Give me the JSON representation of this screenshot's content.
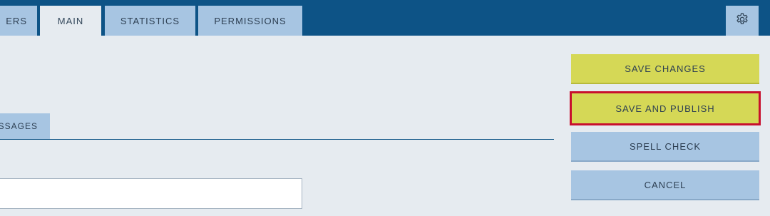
{
  "tabs": [
    {
      "label": "ERS",
      "active": false
    },
    {
      "label": "MAIN",
      "active": true
    },
    {
      "label": "STATISTICS",
      "active": false
    },
    {
      "label": "PERMISSIONS",
      "active": false
    }
  ],
  "settings": {
    "icon": "gear-icon"
  },
  "subtabs": [
    {
      "label": "SSAGES"
    }
  ],
  "input": {
    "value": "",
    "placeholder": ""
  },
  "actions": {
    "save_changes": "SAVE CHANGES",
    "save_and_publish": "SAVE AND PUBLISH",
    "spell_check": "SPELL CHECK",
    "cancel": "CANCEL"
  },
  "colors": {
    "header": "#0d5386",
    "background": "#e6ebf0",
    "tab": "#a7c5e2",
    "primary_button": "#d5d856",
    "focus_outline": "#c8102e"
  }
}
